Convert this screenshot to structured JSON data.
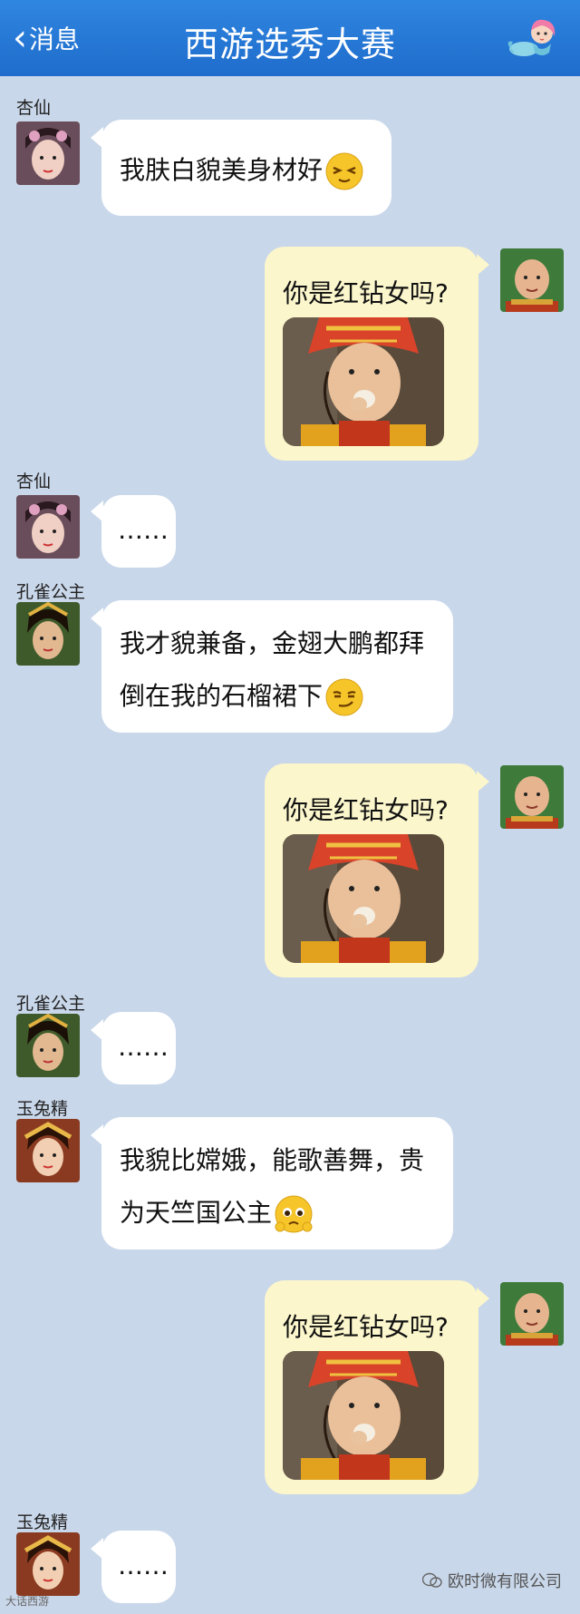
{
  "header": {
    "back_label": "消息",
    "title": "西游选秀大赛"
  },
  "colors": {
    "header_blue": "#2478d8",
    "background": "#c9d7ea",
    "bubble_in": "#ffffff",
    "bubble_out": "#fbf6cc"
  },
  "messages": [
    {
      "sender": "杏仙",
      "text": "我肤白貌美身材好",
      "emoji": "squinting-face-emoji"
    },
    {
      "sender": "me",
      "text": "你是红钻女吗?",
      "image": "tang-monk-eating-egg-photo"
    },
    {
      "sender": "杏仙",
      "text": "……"
    },
    {
      "sender": "孔雀公主",
      "line1": "我才貌兼备，金翅大鹏都拜",
      "line2": "倒在我的石榴裙下",
      "emoji": "smirking-face-emoji"
    },
    {
      "sender": "me",
      "text": "你是红钻女吗?",
      "image": "tang-monk-eating-egg-photo"
    },
    {
      "sender": "孔雀公主",
      "text": "……"
    },
    {
      "sender": "玉兔精",
      "line1": "我貌比嫦娥，能歌善舞，贵",
      "line2": "为天竺国公主",
      "emoji": "pleading-face-emoji"
    },
    {
      "sender": "me",
      "text": "你是红钻女吗?",
      "image": "tang-monk-eating-egg-photo"
    },
    {
      "sender": "玉兔精",
      "text": "……"
    }
  ],
  "watermark": {
    "text": "欧时微有限公司",
    "corner": "大话西游"
  }
}
